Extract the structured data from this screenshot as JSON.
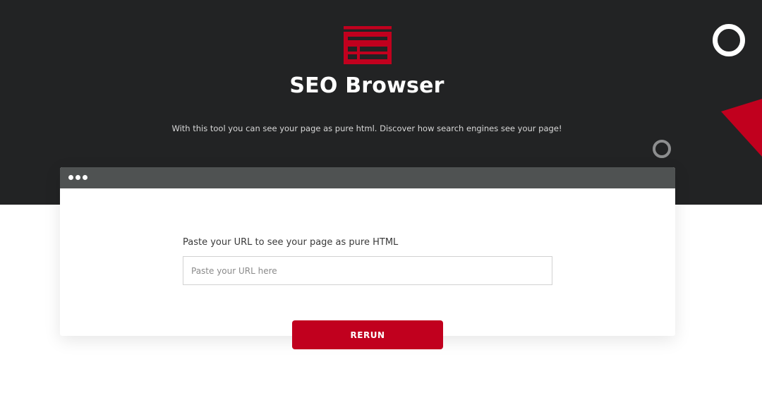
{
  "header": {
    "logo_icon": "browser-window-icon",
    "title": "SEO Browser",
    "subtitle": "With this tool you can see your page as pure html. Discover how search engines see your page!"
  },
  "form": {
    "label": "Paste your URL to see your page as pure HTML",
    "url_placeholder": "Paste your URL here",
    "url_value": "",
    "submit_label": "RERUN"
  },
  "colors": {
    "hero_background": "#222324",
    "brand_red": "#c1001e",
    "window_bar": "#4f5252"
  }
}
